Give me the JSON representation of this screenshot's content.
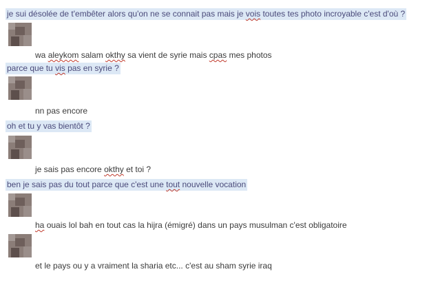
{
  "conversation": {
    "messages": [
      {
        "sender": "self",
        "parts": [
          {
            "t": "je sui désolée de t'embêter alors qu'on ne se connait pas mais je ",
            "u": false
          },
          {
            "t": "vois",
            "u": true
          },
          {
            "t": " toutes tes photo incroyable c'est d'où ?",
            "u": false
          }
        ]
      },
      {
        "sender": "other",
        "parts": [
          {
            "t": "wa ",
            "u": false
          },
          {
            "t": "aleykom",
            "u": true
          },
          {
            "t": " salam ",
            "u": false
          },
          {
            "t": "okthy",
            "u": true
          },
          {
            "t": " sa vient de syrie mais ",
            "u": false
          },
          {
            "t": "cpas",
            "u": true
          },
          {
            "t": " mes photos",
            "u": false
          }
        ]
      },
      {
        "sender": "self",
        "parts": [
          {
            "t": "parce que tu ",
            "u": false
          },
          {
            "t": "vis",
            "u": true
          },
          {
            "t": " pas en syrie ?",
            "u": false
          }
        ]
      },
      {
        "sender": "other",
        "parts": [
          {
            "t": "nn pas encore",
            "u": false
          }
        ]
      },
      {
        "sender": "self",
        "parts": [
          {
            "t": "oh et tu y vas bientôt ?",
            "u": false
          }
        ]
      },
      {
        "sender": "other",
        "parts": [
          {
            "t": "je sais pas encore ",
            "u": false
          },
          {
            "t": "okthy",
            "u": true
          },
          {
            "t": " et toi ?",
            "u": false
          }
        ]
      },
      {
        "sender": "self",
        "parts": [
          {
            "t": "ben je sais pas du tout parce que c'est une ",
            "u": false
          },
          {
            "t": "tout",
            "u": true
          },
          {
            "t": " nouvelle vocation",
            "u": false
          }
        ]
      },
      {
        "sender": "other",
        "parts": [
          {
            "t": "ha",
            "u": true
          },
          {
            "t": " ouais lol bah en tout cas la hijra (émigré) dans un pays musulman c'est  obligatoire",
            "u": false
          }
        ]
      },
      {
        "sender": "other",
        "parts": [
          {
            "t": "et le pays ou y a vraiment la sharia etc... c'est au sham syrie iraq",
            "u": false
          }
        ]
      }
    ]
  },
  "colors": {
    "self_bubble_bg": "#dce8f5",
    "self_text": "#4a4a7a",
    "other_text": "#3a3a3a",
    "spellcheck_underline": "#c0392b",
    "avatar_blur": "#8b7d78"
  },
  "icons": {
    "avatar": "blurred-avatar-icon"
  }
}
